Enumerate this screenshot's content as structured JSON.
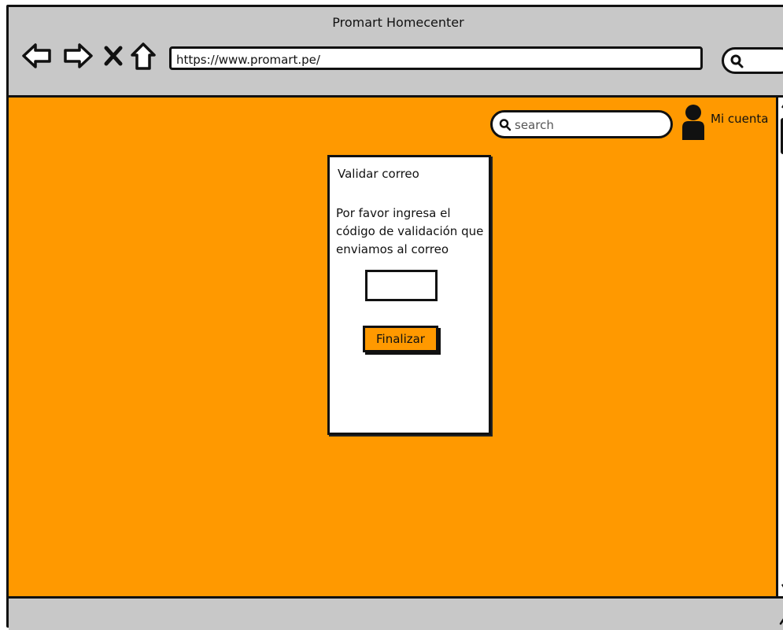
{
  "window": {
    "title": "Promart Homecenter"
  },
  "browser": {
    "url": "https://www.promart.pe/",
    "nav_icons": [
      "back-arrow-icon",
      "forward-arrow-icon",
      "close-x-icon",
      "home-icon"
    ],
    "search_icon": "search-icon"
  },
  "header": {
    "search_placeholder": "search",
    "account_label": "Mi cuenta",
    "account_icon": "user-icon"
  },
  "dialog": {
    "title": "Validar correo",
    "message": "Por favor ingresa el código de validación que enviamos al correo",
    "code_value": "",
    "submit_label": "Finalizar"
  },
  "colors": {
    "accent": "#ff9900",
    "chrome": "#c8c8c8",
    "ink": "#111111"
  }
}
